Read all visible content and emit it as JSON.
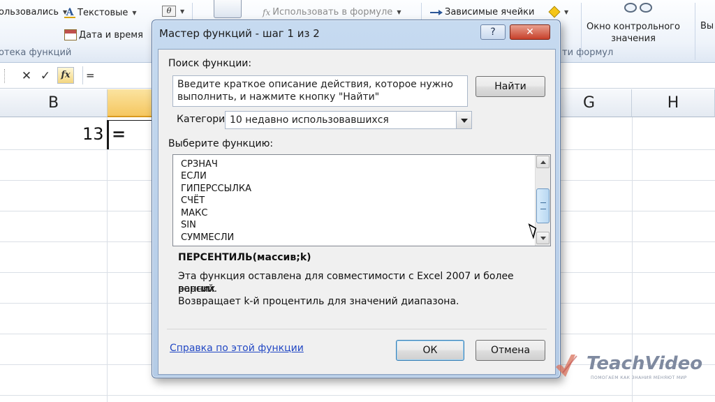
{
  "ribbon": {
    "recent_label": "ользовались",
    "text_label": "Текстовые",
    "date_label": "Дата и время",
    "library_group": "отека функций",
    "use_in_formula": "Использовать в формуле",
    "dependents": "Зависимые ячейки",
    "watch_window": "Окно контрольного значения",
    "watch_line1": "Окно контрольного",
    "watch_line2": "значения",
    "formula_group": "ти формул",
    "cut_label": "Вы"
  },
  "formula_bar": {
    "cancel": "✕",
    "enter": "✓",
    "fx": "fx",
    "content": "="
  },
  "sheet": {
    "columns": [
      "B",
      "",
      "",
      "",
      "",
      "",
      "G",
      "H"
    ],
    "col_b": "B",
    "col_g": "G",
    "col_h": "H",
    "cell_b_value": "13",
    "active_cell_text": "="
  },
  "dialog": {
    "title": "Мастер функций - шаг 1 из 2",
    "help_btn": "?",
    "close_btn": "✕",
    "search_label": "Поиск функции:",
    "search_text": "Введите краткое описание действия, которое нужно выполнить, и нажмите кнопку \"Найти\"",
    "search_line1": "Введите краткое описание действия, которое нужно",
    "search_line2": "выполнить, и нажмите кнопку \"Найти\"",
    "find_btn": "Найти",
    "category_label": "Категория:",
    "category_value": "10 недавно использовавшихся",
    "select_label": "Выберите функцию:",
    "functions": [
      "СРЗНАЧ",
      "ЕСЛИ",
      "ГИПЕРССЫЛКА",
      "СЧЁТ",
      "МАКС",
      "SIN",
      "СУММЕСЛИ"
    ],
    "signature": "ПЕРСЕНТИЛЬ(массив;k)",
    "desc_line1": "Эта функция оставлена для совместимости с Excel 2007 и более ранних",
    "desc_line2": "версий.",
    "desc_line3": "Возвращает k-й процентиль для значений диапазона.",
    "help_link": "Справка по этой функции",
    "ok_btn": "ОК",
    "cancel_btn": "Отмена"
  },
  "watermark": {
    "brand": "TeachVideo",
    "tagline": "ПОМОГАЕМ КАК ЗНАНИЯ МЕНЯЮТ МИР"
  }
}
